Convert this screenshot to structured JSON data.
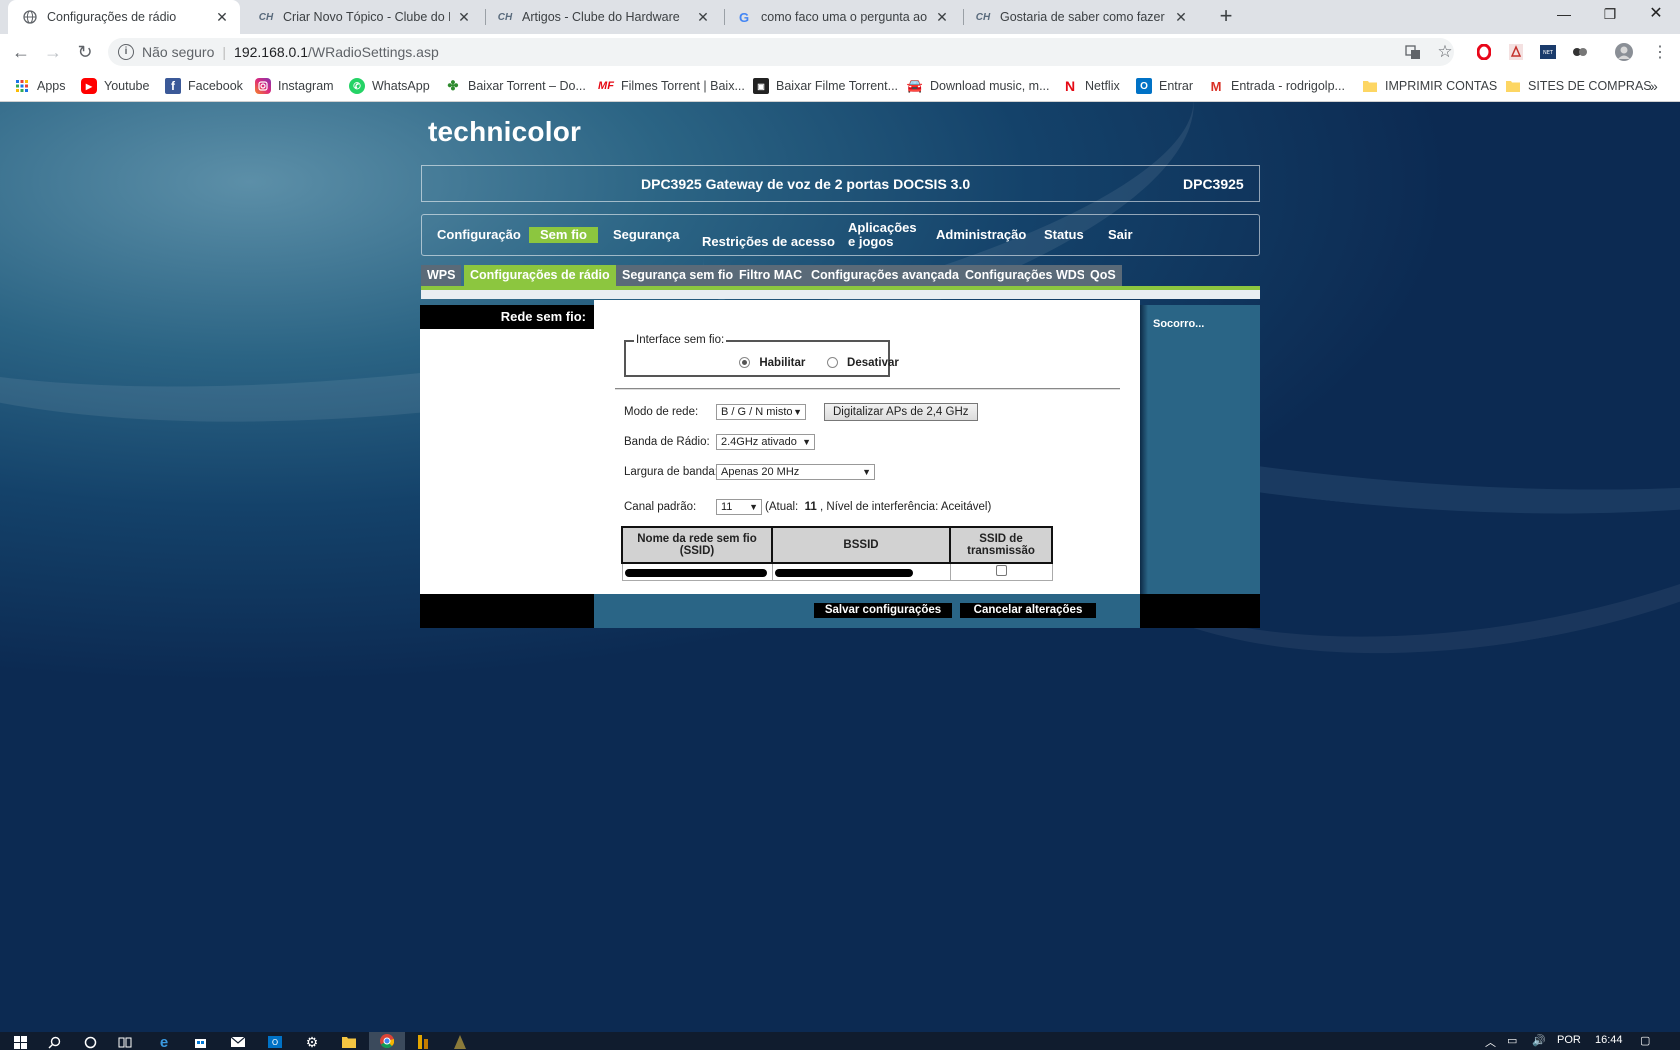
{
  "browser": {
    "tabs": [
      {
        "title": "Configurações de rádio",
        "favicon": "globe-icon"
      },
      {
        "title": "Criar Novo Tópico - Clube do Hardware",
        "favicon": "ch-icon"
      },
      {
        "title": "Artigos - Clube do Hardware",
        "favicon": "ch-icon"
      },
      {
        "title": "como faco uma o pergunta ao clube",
        "favicon": "google-icon"
      },
      {
        "title": "Gostaria de saber como fazer para",
        "favicon": "ch-icon"
      }
    ],
    "insecure_label": "Não seguro",
    "url_host": "192.168.0.1",
    "url_path": "/WRadioSettings.asp",
    "bookmarks": [
      {
        "label": "Apps",
        "icon": "apps-icon"
      },
      {
        "label": "Youtube",
        "icon": "youtube-icon"
      },
      {
        "label": "Facebook",
        "icon": "facebook-icon"
      },
      {
        "label": "Instagram",
        "icon": "instagram-icon"
      },
      {
        "label": "WhatsApp",
        "icon": "whatsapp-icon"
      },
      {
        "label": "Baixar Torrent – Do...",
        "icon": "torrent-icon"
      },
      {
        "label": "Filmes Torrent | Baix...",
        "icon": "mf-icon"
      },
      {
        "label": "Baixar Filme Torrent...",
        "icon": "film-icon"
      },
      {
        "label": "Download music, m...",
        "icon": "car-icon"
      },
      {
        "label": "Netflix",
        "icon": "netflix-icon"
      },
      {
        "label": "Entrar",
        "icon": "outlook-icon"
      },
      {
        "label": "Entrada - rodrigolp...",
        "icon": "gmail-icon"
      },
      {
        "label": "IMPRIMIR CONTAS",
        "icon": "folder-icon"
      },
      {
        "label": "SITES DE COMPRAS",
        "icon": "folder-icon"
      }
    ]
  },
  "router": {
    "brand": "technicolor",
    "device_desc": "DPC3925 Gateway de voz de 2 portas DOCSIS 3.0",
    "model": "DPC3925",
    "main_nav": {
      "config": "Configuração",
      "wireless": "Sem fio",
      "security": "Segurança",
      "access": "Restrições de acesso",
      "apps_l1": "Aplicações",
      "apps_l2": "e jogos",
      "admin": "Administração",
      "status": "Status",
      "exit": "Sair"
    },
    "sub_nav": {
      "wps": "WPS",
      "radio": "Configurações de rádio",
      "wsec": "Segurança sem fio",
      "mac": "Filtro MAC",
      "adv": "Configurações avançadas",
      "wds": "Configurações WDS",
      "qos": "QoS"
    },
    "section_title": "Rede sem fio:",
    "help_link": "Socorro...",
    "interface": {
      "legend": "Interface sem fio:",
      "enable": "Habilitar",
      "disable": "Desativar",
      "selected": "Habilitar"
    },
    "network_mode": {
      "label": "Modo de rede:",
      "value": "B / G / N misto"
    },
    "scan_button": "Digitalizar APs de 2,4 GHz",
    "radio_band": {
      "label": "Banda de Rádio:",
      "value": "2.4GHz ativado"
    },
    "bandwidth": {
      "label": "Largura de banda:",
      "value": "Apenas 20 MHz"
    },
    "channel": {
      "label": "Canal padrão:",
      "value": "11",
      "info_prefix": "(Atual:",
      "current": "11",
      "info_suffix": ", Nível de interferência: Aceitável)"
    },
    "table": {
      "col_ssid_l1": "Nome da rede sem fio",
      "col_ssid_l2": "(SSID)",
      "col_bssid": "BSSID",
      "col_broadcast_l1": "SSID de",
      "col_broadcast_l2": "transmissão",
      "broadcast_checked": false
    },
    "save_button": "Salvar configurações",
    "cancel_button": "Cancelar alterações"
  },
  "taskbar": {
    "language": "POR",
    "time": "16:44"
  }
}
